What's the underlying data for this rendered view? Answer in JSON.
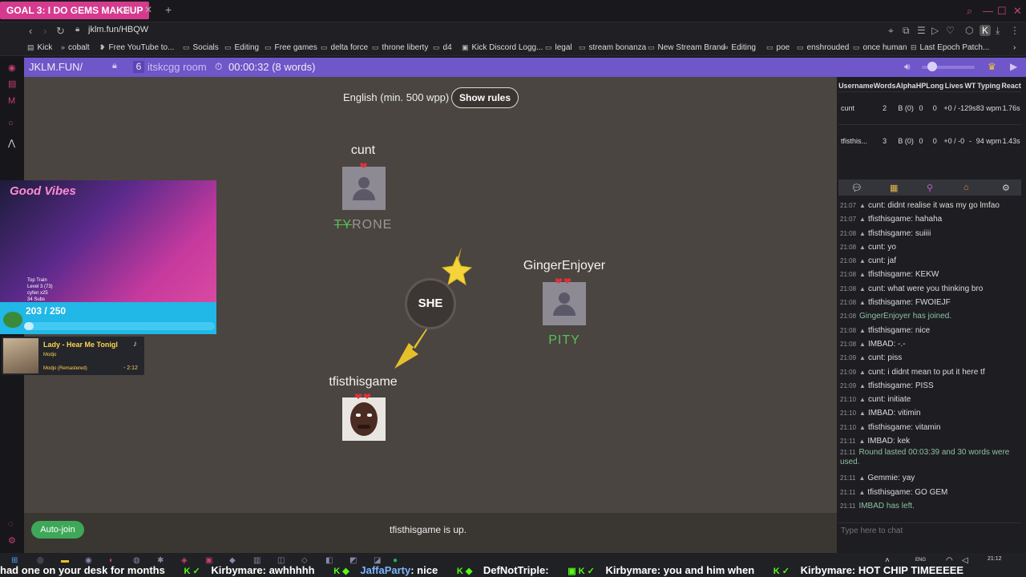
{
  "browser": {
    "stream_goal": "GOAL 3: I DO GEMS MAKEUP",
    "tab_suffix": "om",
    "url": "jklm.fun/HBQW",
    "bookmarks": [
      "Kick",
      "cobalt",
      "Free YouTube to...",
      "Socials",
      "Editing",
      "Free games",
      "delta force",
      "throne liberty",
      "d4",
      "Kick Discord Logg...",
      "legal",
      "stream bonanza",
      "New Stream Brand",
      "Editing",
      "poe",
      "enshrouded",
      "once human",
      "Last Epoch Patch..."
    ]
  },
  "header": {
    "site": "JKLM.FUN/",
    "player_count": "6",
    "room": "itskcgg room",
    "timer": "00:00:32 (8 words)",
    "volume_level": 0.2
  },
  "game": {
    "language": "English (min. 500 wpp)",
    "rules_button": "Show rules",
    "syllable": "SHE",
    "players": [
      {
        "name": "cunt",
        "lives": 1,
        "word_struck": "TY",
        "word_rest": "RONE",
        "icon": "default-avatar-icon"
      },
      {
        "name": "GingerEnjoyer",
        "lives": 2,
        "word": "PITY",
        "icon": "default-avatar-icon"
      },
      {
        "name": "tfisthisgame",
        "lives": 2,
        "icon": "custom-avatar-icon"
      }
    ],
    "autojoin": "Auto-join",
    "status": "tfisthisgame is up."
  },
  "stats": {
    "headers": [
      "Username",
      "Words",
      "Alpha",
      "HP",
      "Long",
      "Lives",
      "WT",
      "Typing",
      "React"
    ],
    "rows": [
      [
        "cunt",
        "2",
        "B (0)",
        "0",
        "0",
        "+0 / -1",
        "29s",
        "83 wpm",
        "1.76s"
      ],
      [
        "tfisthis...",
        "3",
        "B (0)",
        "0",
        "0",
        "+0 / -0",
        "-",
        "94 wpm",
        "1.43s"
      ]
    ]
  },
  "chat": {
    "messages": [
      {
        "time": "21:07",
        "type": "user",
        "text": "cunt: didnt realise it was my go lmfao"
      },
      {
        "time": "21:07",
        "type": "user",
        "text": "tfisthisgame: hahaha"
      },
      {
        "time": "21:08",
        "type": "user",
        "text": "tfisthisgame: suiiii"
      },
      {
        "time": "21:08",
        "type": "user",
        "text": "cunt: yo"
      },
      {
        "time": "21:08",
        "type": "user",
        "text": "cunt: jaf"
      },
      {
        "time": "21:08",
        "type": "user",
        "text": "tfisthisgame: KEKW"
      },
      {
        "time": "21:08",
        "type": "user",
        "text": "cunt: what were you thinking bro"
      },
      {
        "time": "21:08",
        "type": "user",
        "text": "tfisthisgame: FWOIEJF"
      },
      {
        "time": "21:08",
        "type": "sys",
        "text": "GingerEnjoyer has joined."
      },
      {
        "time": "21:08",
        "type": "user",
        "text": "tfisthisgame: nice"
      },
      {
        "time": "21:08",
        "type": "user",
        "text": "IMBAD: -.-"
      },
      {
        "time": "21:09",
        "type": "user",
        "text": "cunt: piss"
      },
      {
        "time": "21:09",
        "type": "user",
        "text": "cunt: i didnt mean to put it here tf"
      },
      {
        "time": "21:09",
        "type": "user",
        "text": "tfisthisgame: PISS"
      },
      {
        "time": "21:10",
        "type": "user",
        "text": "cunt: initiate"
      },
      {
        "time": "21:10",
        "type": "user",
        "text": "IMBAD: vitimin"
      },
      {
        "time": "21:10",
        "type": "user",
        "text": "tfisthisgame: vitamin"
      },
      {
        "time": "21:11",
        "type": "user",
        "text": "IMBAD: kek"
      },
      {
        "time": "21:11",
        "type": "sys-wrap",
        "text": "Round lasted 00:03:39 and 30 words were used."
      },
      {
        "time": "21:11",
        "type": "user",
        "text": "Gemmie: yay"
      },
      {
        "time": "21:11",
        "type": "user",
        "text": "tfisthisgame: GO GEM"
      },
      {
        "time": "21:11",
        "type": "sys",
        "text": "IMBAD has left."
      }
    ],
    "placeholder": "Type here to chat"
  },
  "overlay": {
    "cam_title": "Good Vibes",
    "cam_info": [
      "Top Train",
      "Level 3 (73)",
      "cyfen x25",
      "34 Subs"
    ],
    "sub_count": "203 / 250",
    "sub_progress": 0.05,
    "song_title": "Lady - Hear Me Tonigl",
    "song_artist": "Modjo",
    "song_album": "Modjo (Remastered)",
    "song_time": "- 2:12"
  },
  "taskbar": {
    "lang": "ENG",
    "time": "21:12",
    "ticker": [
      {
        "name": "",
        "text": "had one on your desk for months"
      },
      {
        "name": "Kirbymare",
        "text": ": awhhhhh"
      },
      {
        "name": "JaffaParty",
        "text": ": nice"
      },
      {
        "name": "DefNotTriple",
        "text": ":"
      },
      {
        "name": "Kirbymare",
        "text": ": you and him when"
      },
      {
        "name": "Kirbymare",
        "text": ": HOT CHIP TIMEEEEE"
      }
    ]
  }
}
